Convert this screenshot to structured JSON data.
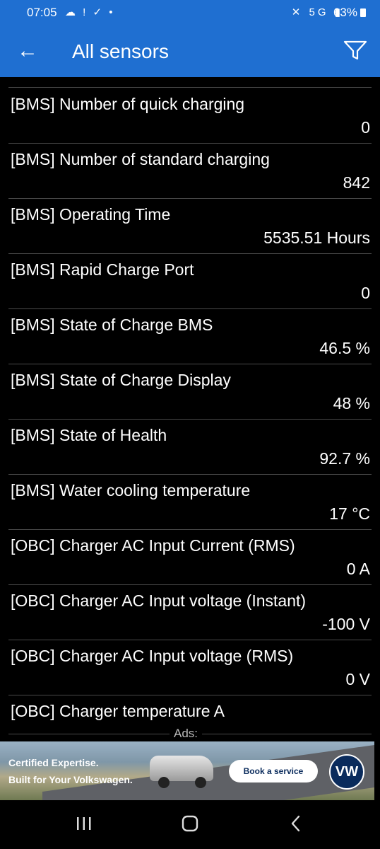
{
  "status_bar": {
    "time": "07:05",
    "left_icons": [
      "cloud-icon",
      "alert-icon",
      "check-circle-icon",
      "dot-icon"
    ],
    "right_icons": [
      "mute-icon",
      "5g-icon",
      "signal-icon"
    ],
    "battery": "63%"
  },
  "app_bar": {
    "title": "All sensors",
    "back_icon": "arrow-left-icon",
    "filter_icon": "filter-icon"
  },
  "sensors": [
    {
      "name": "[BMS] Number of quick charging",
      "value": "0"
    },
    {
      "name": "[BMS] Number of standard charging",
      "value": "842"
    },
    {
      "name": "[BMS] Operating Time",
      "value": "5535.51 Hours"
    },
    {
      "name": "[BMS] Rapid Charge Port",
      "value": "0"
    },
    {
      "name": "[BMS] State of Charge BMS",
      "value": "46.5 %"
    },
    {
      "name": "[BMS] State of Charge Display",
      "value": "48 %"
    },
    {
      "name": "[BMS] State of Health",
      "value": "92.7 %"
    },
    {
      "name": "[BMS] Water cooling temperature",
      "value": "17 °C"
    },
    {
      "name": "[OBC] Charger AC Input Current (RMS)",
      "value": "0 A"
    },
    {
      "name": "[OBC] Charger AC Input voltage (Instant)",
      "value": "-100 V"
    },
    {
      "name": "[OBC] Charger AC Input voltage (RMS)",
      "value": "0 V"
    },
    {
      "name": "[OBC] Charger temperature A",
      "value": ""
    }
  ],
  "ads": {
    "label": "Ads:",
    "line1": "Certified Expertise.",
    "line2": "Built for Your Volkswagen.",
    "cta": "Book a service",
    "logo": "VW"
  },
  "nav_bar": {
    "icons": [
      "recents-icon",
      "home-icon",
      "back-icon"
    ]
  },
  "colors": {
    "accent": "#1f6fd1",
    "background": "#000000",
    "divider": "#4a4a4a",
    "text": "#ffffff"
  }
}
